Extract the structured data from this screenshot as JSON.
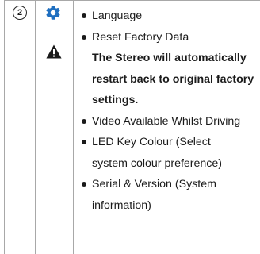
{
  "row": {
    "step_number": "2",
    "icons": {
      "settings": "gear-icon",
      "warning": "warning-triangle-icon"
    },
    "colors": {
      "gear": "#1f6fc0",
      "text": "#1a1a1a",
      "rule": "#a8a8a8"
    },
    "items": [
      "Language",
      "Reset Factory Data"
    ],
    "warning_lines": [
      "The Stereo will automatically",
      "restart back to original factory",
      "settings."
    ],
    "more_items": [
      "Video Available Whilst Driving",
      "LED Key Colour (Select",
      "system colour preference)",
      "Serial & Version (System",
      "information)"
    ]
  }
}
